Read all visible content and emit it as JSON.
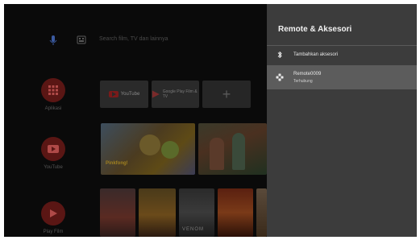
{
  "home": {
    "search_hint": "Search film, TV dan lainnya",
    "apps": [
      {
        "label": "Aplikasi",
        "icon": "apps-grid-icon",
        "color": "#c0392b"
      },
      {
        "label": "YouTube",
        "icon": "youtube-play-icon",
        "color": "#c0392b"
      },
      {
        "label": "Play Film",
        "icon": "play-movies-icon",
        "color": "#c0392b"
      }
    ],
    "favorites": {
      "youtube_label": "YouTube",
      "google_play_label": "Google Play Film & TV",
      "add_icon": "add-icon"
    },
    "featured": {
      "brand": "Pinkfong!"
    },
    "posters": {
      "p3_title": "VENOM"
    }
  },
  "panel": {
    "title": "Remote & Aksesori",
    "items": [
      {
        "label": "Tambahkan aksesori",
        "icon": "bluetooth-icon"
      },
      {
        "label": "Remote0009",
        "sub": "Terhubung",
        "icon": "gamepad-icon"
      }
    ],
    "bg_color": "#3c3c3c",
    "selected_color": "#5c5c5c"
  }
}
